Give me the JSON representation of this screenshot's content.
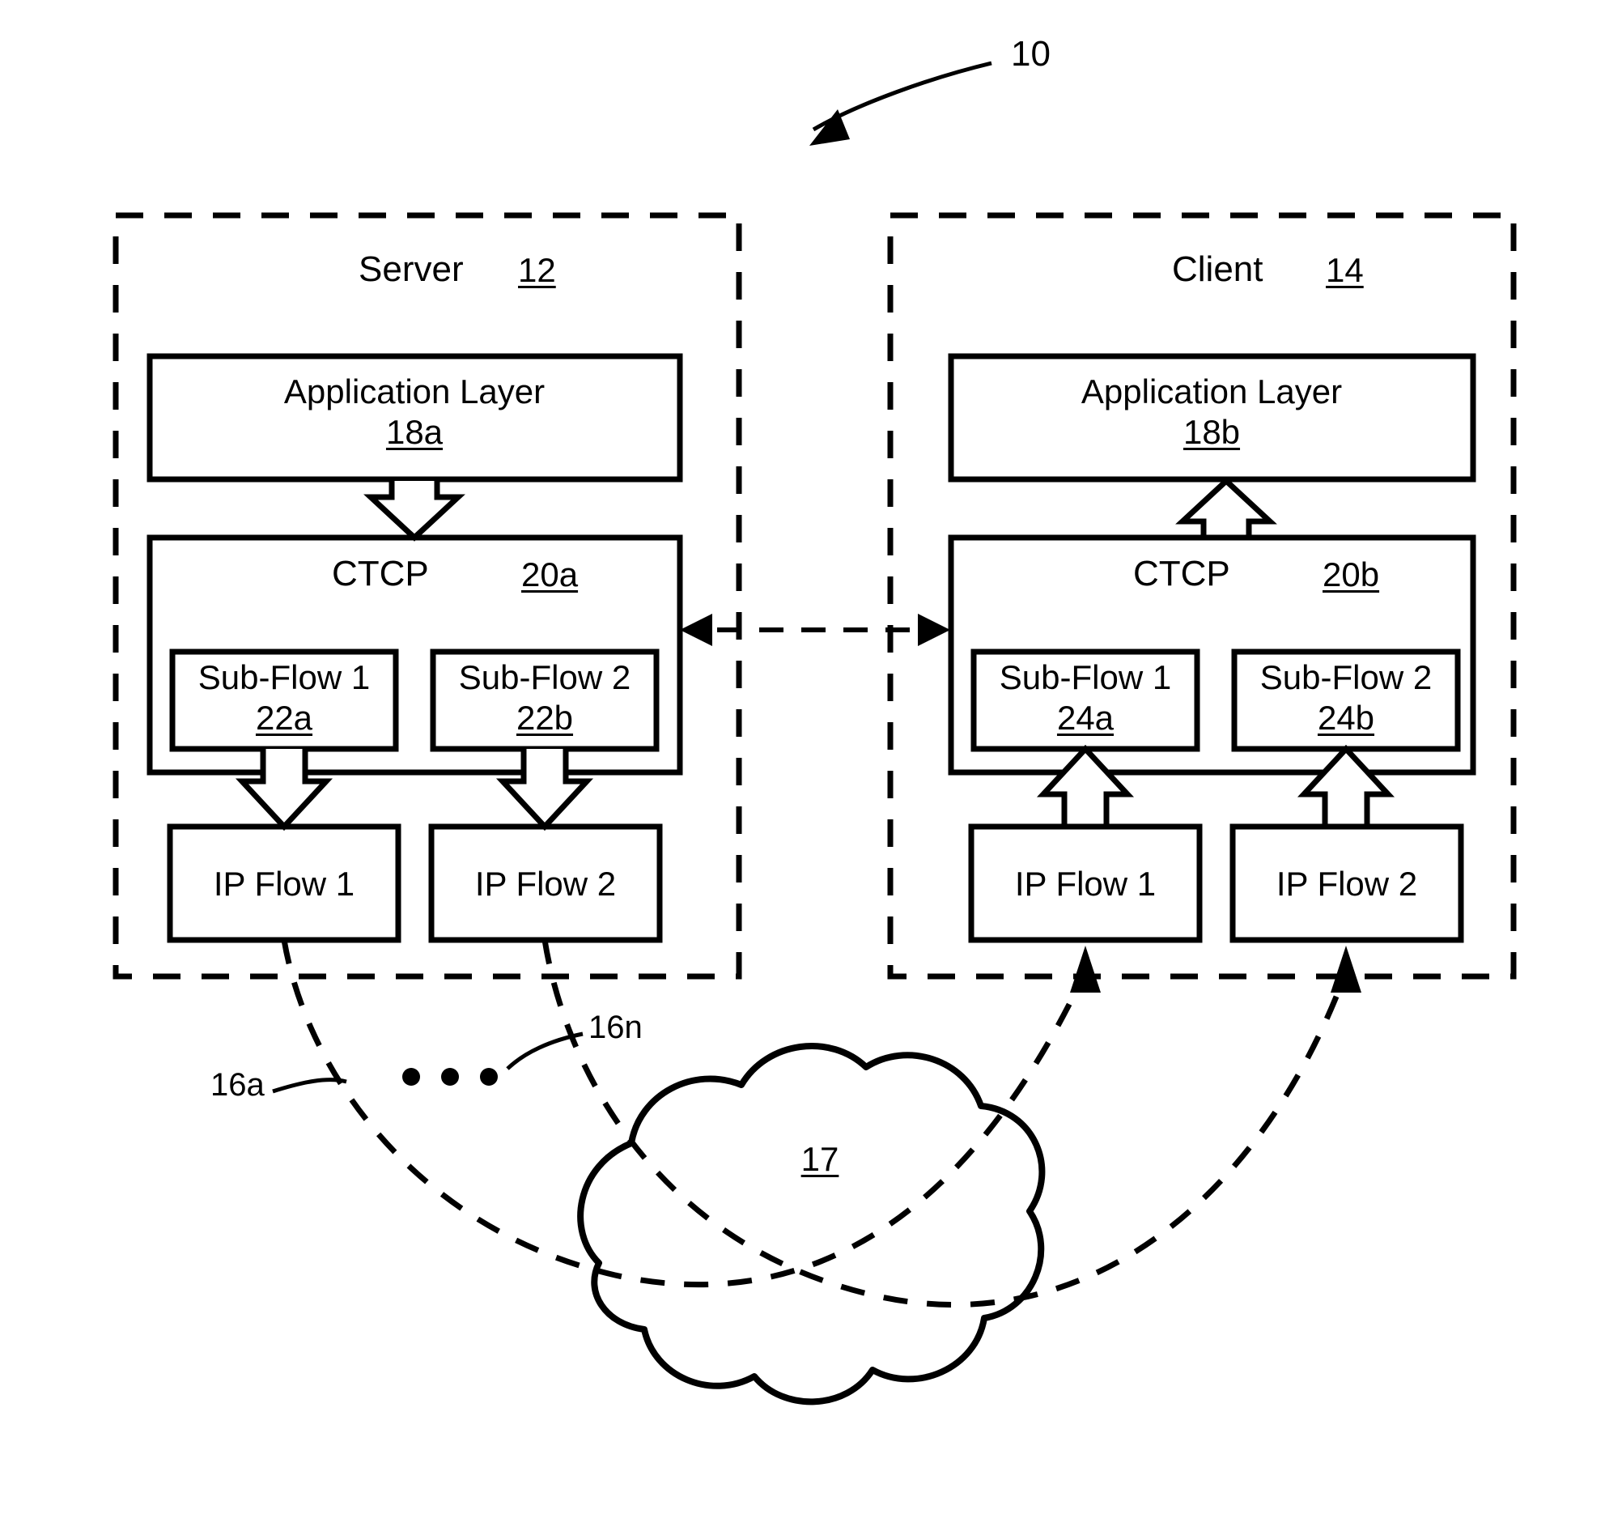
{
  "figure": {
    "overall_ref": "10",
    "network_cloud_ref": "17",
    "link_label_first": "16a",
    "link_label_last": "16n",
    "ellipsis": "•  •  •"
  },
  "server": {
    "title": "Server",
    "ref": "12",
    "application_layer": {
      "label": "Application Layer",
      "ref": "18a"
    },
    "ctcp": {
      "label": "CTCP",
      "ref": "20a"
    },
    "subflows": [
      {
        "label": "Sub-Flow 1",
        "ref": "22a"
      },
      {
        "label": "Sub-Flow 2",
        "ref": "22b"
      }
    ],
    "ip_flows": [
      {
        "label": "IP Flow 1"
      },
      {
        "label": "IP Flow 2"
      }
    ]
  },
  "client": {
    "title": "Client",
    "ref": "14",
    "application_layer": {
      "label": "Application Layer",
      "ref": "18b"
    },
    "ctcp": {
      "label": "CTCP",
      "ref": "20b"
    },
    "subflows": [
      {
        "label": "Sub-Flow 1",
        "ref": "24a"
      },
      {
        "label": "Sub-Flow 2",
        "ref": "24b"
      }
    ],
    "ip_flows": [
      {
        "label": "IP Flow 1"
      },
      {
        "label": "IP Flow 2"
      }
    ]
  },
  "colors": {
    "ink": "#000000",
    "paper": "#ffffff"
  }
}
